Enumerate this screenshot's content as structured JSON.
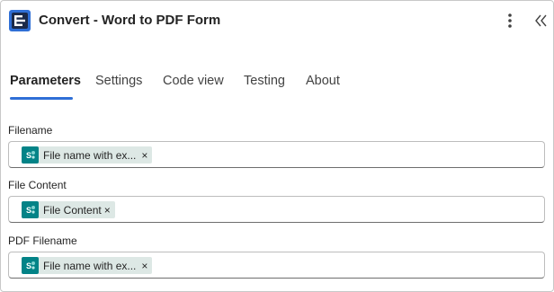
{
  "header": {
    "title": "Convert - Word to PDF Form",
    "more_icon": "more-vertical-icon",
    "collapse_icon": "double-chevron-left-icon",
    "app_icon": "app-logo-icon"
  },
  "tabs": [
    {
      "label": "Parameters",
      "active": true
    },
    {
      "label": "Settings",
      "active": false
    },
    {
      "label": "Code view",
      "active": false
    },
    {
      "label": "Testing",
      "active": false
    },
    {
      "label": "About",
      "active": false
    }
  ],
  "fields": [
    {
      "label": "Filename",
      "token": {
        "text": "File name with ex...",
        "remove": "×",
        "icon": "sharepoint-icon"
      }
    },
    {
      "label": "File Content",
      "token": {
        "text": "File Content",
        "remove": "×",
        "icon": "sharepoint-icon"
      }
    },
    {
      "label": "PDF Filename",
      "token": {
        "text": "File name with ex...",
        "remove": "×",
        "icon": "sharepoint-icon"
      }
    }
  ],
  "colors": {
    "accent": "#2f6fd6",
    "token_bg": "#dde8e5",
    "sharepoint": "#038387"
  }
}
